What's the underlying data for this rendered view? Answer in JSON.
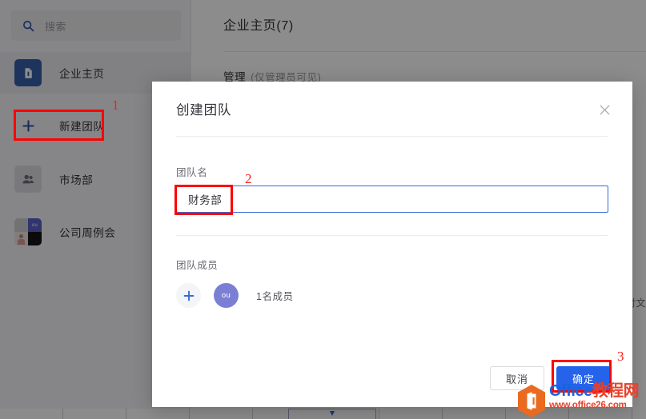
{
  "sidebar": {
    "search": {
      "placeholder": "搜索",
      "icon": "search-icon"
    },
    "items": [
      {
        "label": "企业主页",
        "icon": "home-page-icon",
        "tile": "brand"
      },
      {
        "label": "新建团队",
        "icon": "plus-icon",
        "tile": "plain"
      },
      {
        "label": "市场部",
        "icon": "group-icon",
        "tile": "grey"
      },
      {
        "label": "公司周例会",
        "icon": "avatar-mosaic-icon",
        "tile": "mosaic",
        "avatar_text": "ou"
      }
    ]
  },
  "content": {
    "title": "企业主页(7)",
    "section": "管理",
    "section_note": "(仅管理员可见)",
    "edge_text": "对文"
  },
  "modal": {
    "title": "创建团队",
    "close_icon": "close-icon",
    "team_name_label": "团队名",
    "team_name_value": "财务部",
    "members_label": "团队成员",
    "add_member_icon": "plus-icon",
    "member_avatar_text": "ou",
    "member_count": "1名成员",
    "cancel_label": "取消",
    "confirm_label": "确定"
  },
  "annotations": {
    "step1": "1",
    "step2": "2",
    "step3": "3",
    "color": "#ff0000"
  },
  "watermark": {
    "brand_en": "Office",
    "brand_cn": "教程网",
    "url": "www.office26.com"
  },
  "colors": {
    "accent_blue": "#2563eb",
    "input_border": "#3a6ad6",
    "avatar_purple": "#7b7fd4",
    "annotation_red": "#ff0000"
  }
}
